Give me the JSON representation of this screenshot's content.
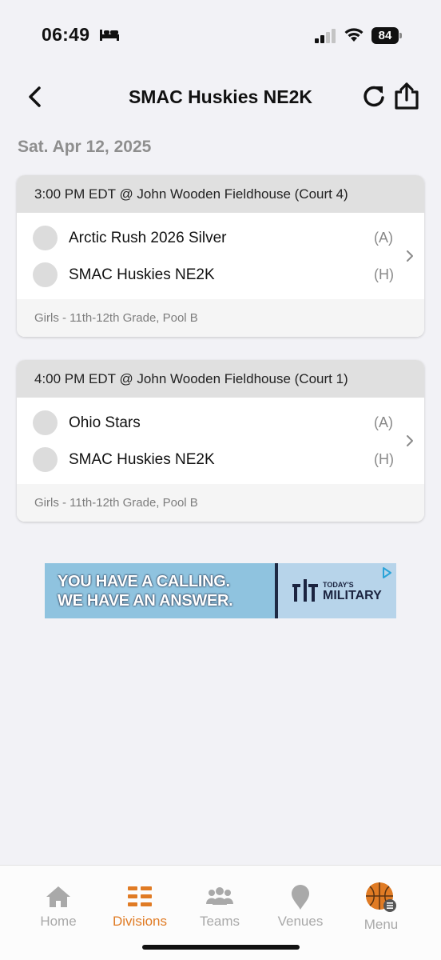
{
  "status_bar": {
    "time": "06:49",
    "battery": "84"
  },
  "header": {
    "title": "SMAC Huskies NE2K"
  },
  "date": "Sat. Apr 12, 2025",
  "games": [
    {
      "time_venue": "3:00 PM EDT @ John Wooden Fieldhouse (Court 4)",
      "teams": [
        {
          "name": "Arctic Rush 2026 Silver",
          "side": "(A)"
        },
        {
          "name": "SMAC Huskies NE2K",
          "side": "(H)"
        }
      ],
      "division": "Girls - 11th-12th Grade, Pool B"
    },
    {
      "time_venue": "4:00 PM EDT @ John Wooden Fieldhouse (Court 1)",
      "teams": [
        {
          "name": "Ohio Stars",
          "side": "(A)"
        },
        {
          "name": "SMAC Huskies NE2K",
          "side": "(H)"
        }
      ],
      "division": "Girls - 11th-12th Grade, Pool B"
    }
  ],
  "ad": {
    "line1": "YOU HAVE A CALLING.",
    "line2": "WE HAVE AN ANSWER.",
    "brand_small": "TODAY'S",
    "brand_big": "MILITARY"
  },
  "tabs": [
    {
      "label": "Home",
      "icon": "home-icon",
      "active": false
    },
    {
      "label": "Divisions",
      "icon": "divisions-icon",
      "active": true
    },
    {
      "label": "Teams",
      "icon": "teams-icon",
      "active": false
    },
    {
      "label": "Venues",
      "icon": "venue-pin-icon",
      "active": false
    },
    {
      "label": "Menu",
      "icon": "basketball-menu-icon",
      "active": false
    }
  ],
  "colors": {
    "accent": "#e07b24",
    "inactive": "#a9a9a9",
    "background": "#f2f2f6"
  }
}
